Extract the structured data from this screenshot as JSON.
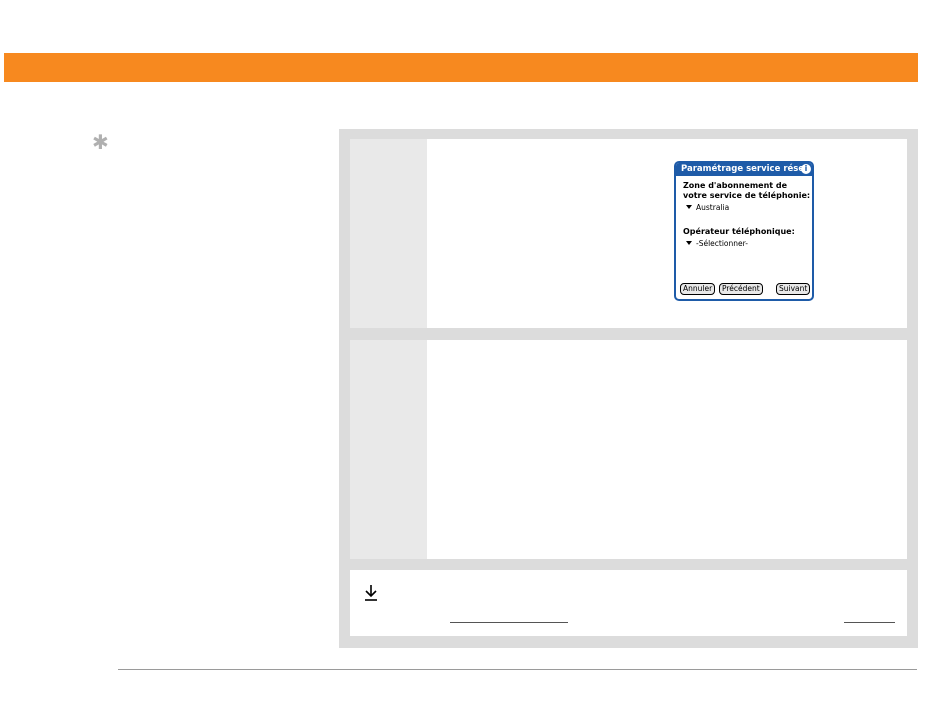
{
  "dialog": {
    "title": "Paramétrage service résea",
    "info_glyph": "i",
    "zone_label": "Zone d'abonnement de votre service de téléphonie:",
    "zone_value": "Australia",
    "operator_label": "Opérateur téléphonique:",
    "operator_value": "-Sélectionner-",
    "buttons": {
      "cancel": "Annuler",
      "previous": "Précédent",
      "next": "Suivant"
    }
  },
  "icons": {
    "tip": "asterisk-icon",
    "done": "down-arrow-icon"
  },
  "colors": {
    "header_bar": "#f7891f",
    "dialog_blue": "#1e5ba8",
    "panel_gray": "#dcdcdc"
  }
}
